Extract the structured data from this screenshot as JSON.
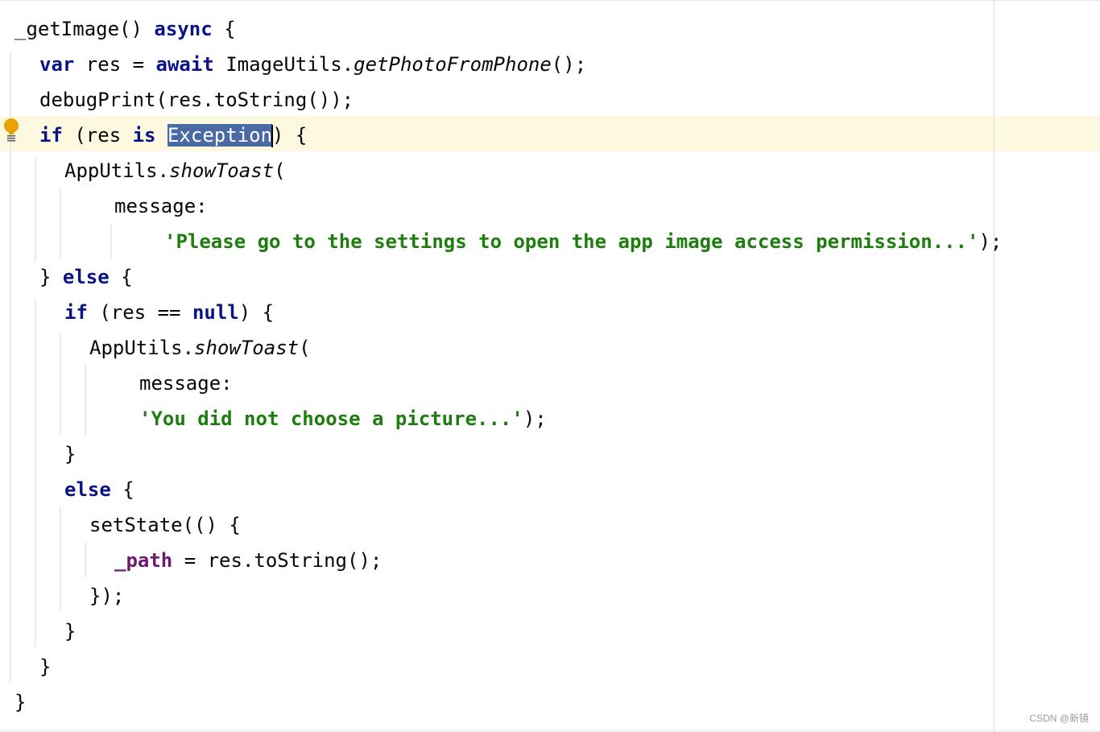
{
  "editor": {
    "lines": [
      {
        "parts": [
          {
            "t": "_getImage() ",
            "c": ""
          },
          {
            "t": "async",
            "c": "kw"
          },
          {
            "t": " {",
            "c": ""
          }
        ]
      },
      {
        "parts": [
          {
            "t": "var",
            "c": "kw"
          },
          {
            "t": " res = ",
            "c": ""
          },
          {
            "t": "await",
            "c": "kw"
          },
          {
            "t": " ImageUtils.",
            "c": ""
          },
          {
            "t": "getPhotoFromPhone",
            "c": "fn-italic"
          },
          {
            "t": "();",
            "c": ""
          }
        ]
      },
      {
        "parts": [
          {
            "t": "debugPrint(res.toString());",
            "c": ""
          }
        ]
      },
      {
        "parts": [
          {
            "t": "if",
            "c": "kw"
          },
          {
            "t": " (res ",
            "c": ""
          },
          {
            "t": "is",
            "c": "kw"
          },
          {
            "t": " ",
            "c": ""
          },
          {
            "t": "Exception",
            "c": "selected"
          },
          {
            "t": "",
            "c": "caret"
          },
          {
            "t": ") {",
            "c": ""
          }
        ]
      },
      {
        "parts": [
          {
            "t": "AppUtils.",
            "c": ""
          },
          {
            "t": "showToast",
            "c": "fn-italic"
          },
          {
            "t": "(",
            "c": ""
          }
        ]
      },
      {
        "parts": [
          {
            "t": "message:",
            "c": ""
          }
        ]
      },
      {
        "parts": [
          {
            "t": "'Please go to the settings to open the app image access permission...'",
            "c": "str"
          },
          {
            "t": ");",
            "c": ""
          }
        ]
      },
      {
        "parts": [
          {
            "t": "} ",
            "c": ""
          },
          {
            "t": "else",
            "c": "kw"
          },
          {
            "t": " {",
            "c": ""
          }
        ]
      },
      {
        "parts": [
          {
            "t": "if",
            "c": "kw"
          },
          {
            "t": " (res == ",
            "c": ""
          },
          {
            "t": "null",
            "c": "kw"
          },
          {
            "t": ") {",
            "c": ""
          }
        ]
      },
      {
        "parts": [
          {
            "t": "AppUtils.",
            "c": ""
          },
          {
            "t": "showToast",
            "c": "fn-italic"
          },
          {
            "t": "(",
            "c": ""
          }
        ]
      },
      {
        "parts": [
          {
            "t": "message:",
            "c": ""
          }
        ]
      },
      {
        "parts": [
          {
            "t": "'You did not choose a picture...'",
            "c": "str"
          },
          {
            "t": ");",
            "c": ""
          }
        ]
      },
      {
        "parts": [
          {
            "t": "}",
            "c": ""
          }
        ]
      },
      {
        "parts": [
          {
            "t": "else",
            "c": "kw"
          },
          {
            "t": " {",
            "c": ""
          }
        ]
      },
      {
        "parts": [
          {
            "t": "setState(() {",
            "c": ""
          }
        ]
      },
      {
        "parts": [
          {
            "t": "_path",
            "c": "field"
          },
          {
            "t": " = res.toString();",
            "c": ""
          }
        ]
      },
      {
        "parts": [
          {
            "t": "});",
            "c": ""
          }
        ]
      },
      {
        "parts": [
          {
            "t": "}",
            "c": ""
          }
        ]
      },
      {
        "parts": [
          {
            "t": "}",
            "c": ""
          }
        ]
      },
      {
        "parts": [
          {
            "t": "}",
            "c": ""
          }
        ]
      }
    ]
  },
  "gutter": {
    "intention_icon": "lightbulb-icon"
  },
  "watermark": "CSDN @新镜",
  "colors": {
    "keyword": "#0a1487",
    "string": "#1e7d0f",
    "field": "#6e1a73",
    "selection": "#4a6aa6",
    "current_line": "#fdf9e1"
  }
}
